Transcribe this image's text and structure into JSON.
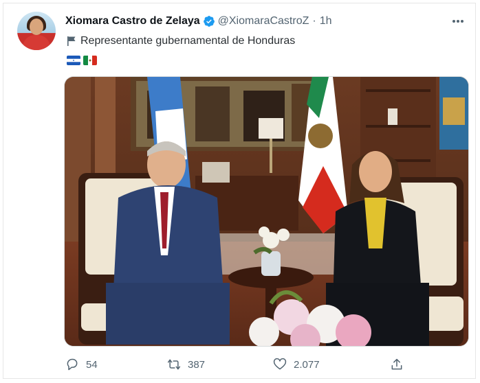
{
  "author": {
    "name": "Xiomara Castro de Zelaya",
    "handle": "@XiomaraCastroZ",
    "separator": "·",
    "time": "1h",
    "bio": "Representante gubernamental de Honduras"
  },
  "flags": [
    "honduras-flag",
    "mexico-flag"
  ],
  "media": {
    "icon": "photo-meeting"
  },
  "stats": {
    "replies": "54",
    "retweets": "387",
    "likes": "2.077"
  },
  "colors": {
    "verified": "#1d9bf0",
    "muted": "#536471",
    "text": "#0f1419"
  }
}
